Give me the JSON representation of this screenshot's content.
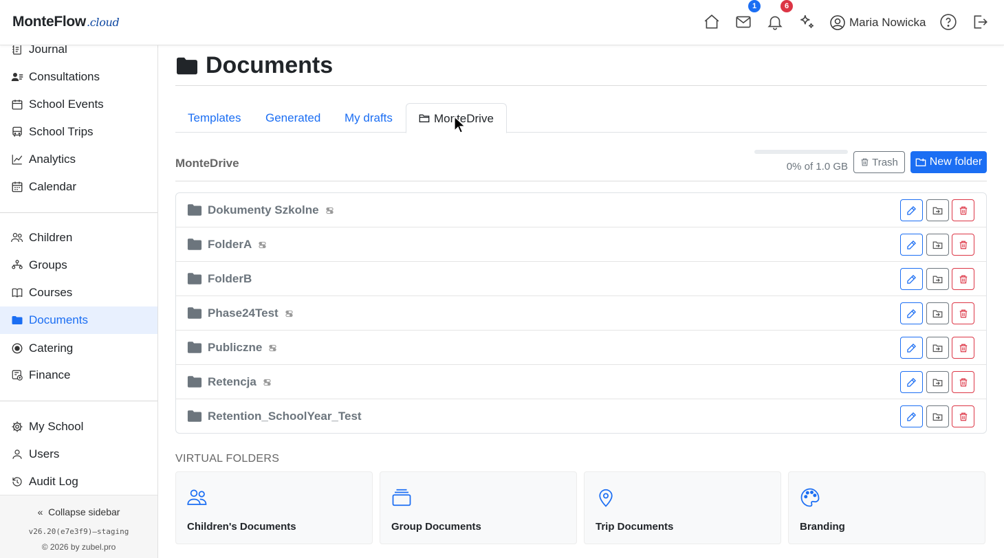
{
  "header": {
    "brand_main": "MonteFlow",
    "brand_suffix": ".cloud",
    "messages_badge": "1",
    "notifications_badge": "6",
    "user_name": "Maria Nowicka"
  },
  "sidebar": {
    "items": [
      {
        "label": "Journal",
        "icon": "journal-icon"
      },
      {
        "label": "Consultations",
        "icon": "consultations-icon"
      },
      {
        "label": "School Events",
        "icon": "calendar-event-icon"
      },
      {
        "label": "School Trips",
        "icon": "bus-icon"
      },
      {
        "label": "Analytics",
        "icon": "chart-line-icon"
      },
      {
        "label": "Calendar",
        "icon": "calendar-icon"
      },
      {
        "label": "Children",
        "icon": "children-icon"
      },
      {
        "label": "Groups",
        "icon": "groups-icon"
      },
      {
        "label": "Courses",
        "icon": "book-icon"
      },
      {
        "label": "Documents",
        "icon": "folder-icon"
      },
      {
        "label": "Catering",
        "icon": "catering-icon"
      },
      {
        "label": "Finance",
        "icon": "finance-icon"
      },
      {
        "label": "My School",
        "icon": "gear-icon"
      },
      {
        "label": "Users",
        "icon": "user-icon"
      },
      {
        "label": "Audit Log",
        "icon": "history-icon"
      }
    ],
    "active": "Documents",
    "collapse_label": "Collapse sidebar",
    "version": "v26.20(e7e3f9)—staging",
    "copyright": "© 2026 by zubel.pro"
  },
  "page": {
    "title": "Documents",
    "tabs": [
      "Templates",
      "Generated",
      "My drafts",
      "MonteDrive"
    ],
    "active_tab": "MonteDrive",
    "section_title": "MonteDrive",
    "usage_percent": 0,
    "usage_text": "0% of 1.0 GB",
    "trash_label": "Trash",
    "new_folder_label": "New folder"
  },
  "folders": [
    {
      "name": "Dokumenty Szkolne",
      "toggle": true
    },
    {
      "name": "FolderA",
      "toggle": true
    },
    {
      "name": "FolderB",
      "toggle": false
    },
    {
      "name": "Phase24Test",
      "toggle": true
    },
    {
      "name": "Publiczne",
      "toggle": true
    },
    {
      "name": "Retencja",
      "toggle": true
    },
    {
      "name": "Retention_SchoolYear_Test",
      "toggle": false
    }
  ],
  "virtual_folders": {
    "heading": "VIRTUAL FOLDERS",
    "items": [
      {
        "label": "Children's Documents",
        "icon": "people-icon"
      },
      {
        "label": "Group Documents",
        "icon": "stack-icon"
      },
      {
        "label": "Trip Documents",
        "icon": "map-pin-icon"
      },
      {
        "label": "Branding",
        "icon": "palette-icon"
      }
    ]
  },
  "colors": {
    "accent": "#1b6ef3",
    "danger": "#dc3545",
    "muted": "#6c757d",
    "active_bg": "#e8f0fe"
  }
}
